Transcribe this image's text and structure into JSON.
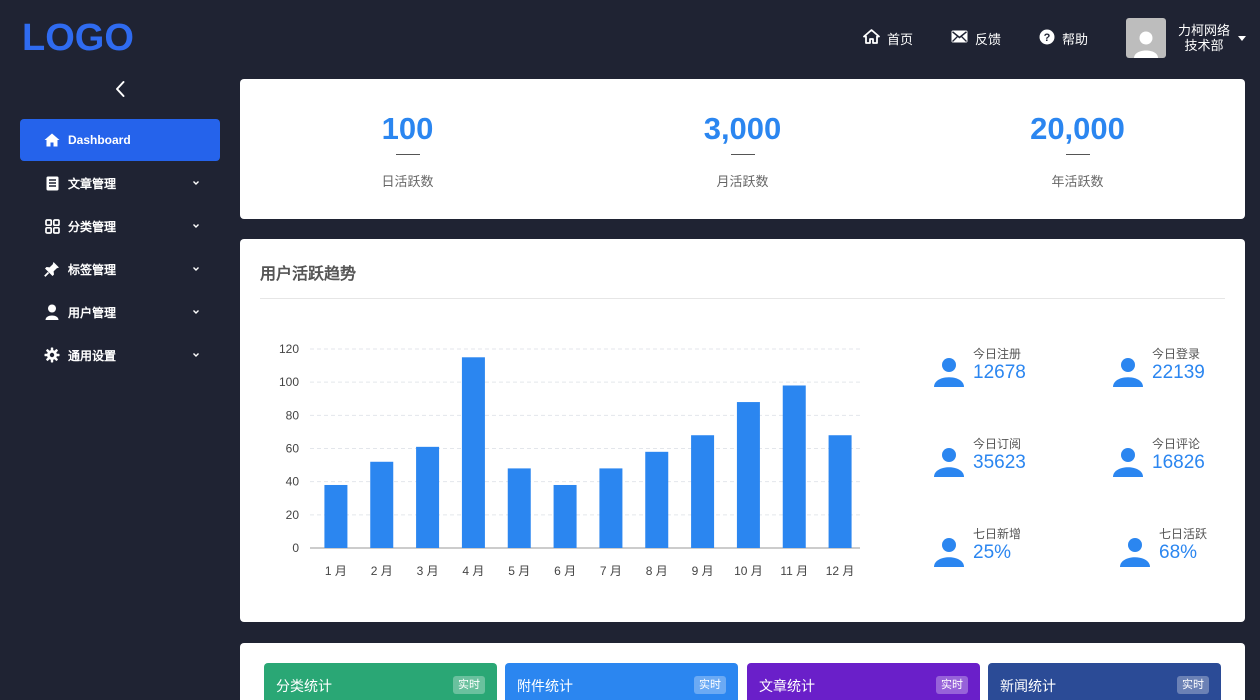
{
  "header": {
    "logo": "LOGO",
    "nav": [
      {
        "icon": "home-icon",
        "label": "首页"
      },
      {
        "icon": "mail-icon",
        "label": "反馈"
      },
      {
        "icon": "help-icon",
        "label": "帮助"
      }
    ],
    "user": {
      "company": "力柯网络",
      "department": "技术部"
    }
  },
  "sidebar": {
    "items": [
      {
        "icon": "home-icon",
        "label": "Dashboard",
        "active": true
      },
      {
        "icon": "document-icon",
        "label": "文章管理"
      },
      {
        "icon": "grid-icon",
        "label": "分类管理"
      },
      {
        "icon": "pin-icon",
        "label": "标签管理"
      },
      {
        "icon": "user-icon",
        "label": "用户管理"
      },
      {
        "icon": "gear-icon",
        "label": "通用设置"
      }
    ]
  },
  "stats": [
    {
      "value": "100",
      "label": "日活跃数"
    },
    {
      "value": "3,000",
      "label": "月活跃数"
    },
    {
      "value": "20,000",
      "label": "年活跃数"
    }
  ],
  "trend": {
    "title": "用户活跃趋势",
    "kpis": [
      {
        "label": "今日注册",
        "value": "12678"
      },
      {
        "label": "今日登录",
        "value": "22139"
      },
      {
        "label": "今日订阅",
        "value": "35623"
      },
      {
        "label": "今日评论",
        "value": "16826"
      },
      {
        "label": "七日新增",
        "value": "25%"
      },
      {
        "label": "七日活跃",
        "value": "68%"
      }
    ]
  },
  "chart_data": {
    "type": "bar",
    "title": "",
    "xlabel": "",
    "ylabel": "",
    "categories": [
      "1 月",
      "2 月",
      "3 月",
      "4 月",
      "5 月",
      "6 月",
      "7 月",
      "8 月",
      "9 月",
      "10 月",
      "11 月",
      "12 月"
    ],
    "values": [
      38,
      52,
      61,
      115,
      48,
      38,
      48,
      58,
      68,
      88,
      98,
      68
    ],
    "ylim": [
      0,
      120
    ],
    "yticks": [
      0,
      20,
      40,
      60,
      80,
      100,
      120
    ],
    "grid": true,
    "color": "#2b86f0"
  },
  "bottom": [
    {
      "label": "分类统计",
      "badge": "实时",
      "color": "#2aa775"
    },
    {
      "label": "附件统计",
      "badge": "实时",
      "color": "#2b86f0"
    },
    {
      "label": "文章统计",
      "badge": "实时",
      "color": "#6a1fc9"
    },
    {
      "label": "新闻统计",
      "badge": "实时",
      "color": "#2b4b96"
    }
  ]
}
